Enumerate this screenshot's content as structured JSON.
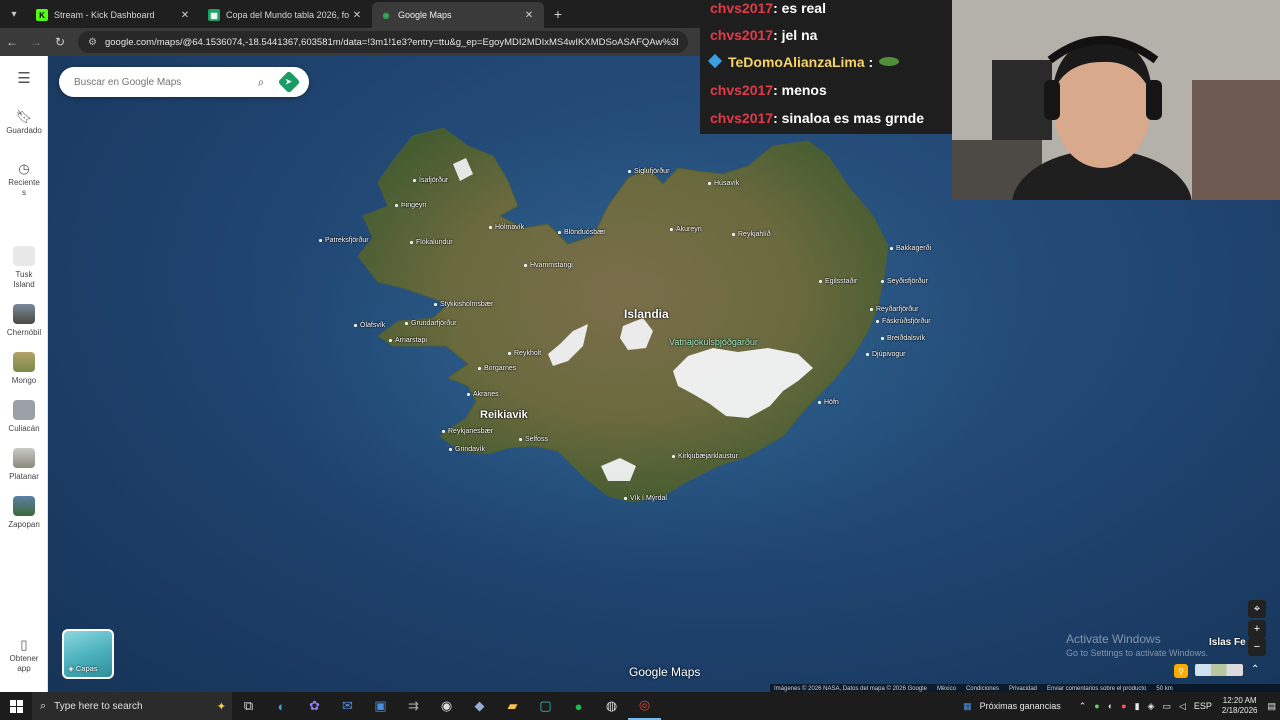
{
  "browser": {
    "tabs": [
      {
        "label": "Stream - Kick Dashboard",
        "favicon": "kick-icon",
        "color": "#53fc18"
      },
      {
        "label": "Copa del Mundo tabla 2026, fo",
        "favicon": "sheets-icon",
        "color": "#1ea362"
      },
      {
        "label": "Google Maps",
        "favicon": "maps-icon",
        "color": "#34a853"
      }
    ],
    "url": "google.com/maps/@64.1536074,-18.5441367,603581m/data=!3m1!1e3?entry=ttu&g_ep=EgoyMDI2MDIxMS4wIKXMDSoASAFQAw%3D%3D"
  },
  "rail": {
    "items": [
      {
        "label": "Guardado",
        "icon": "bookmark-icon"
      },
      {
        "label": "Reciente s",
        "icon": "history-icon"
      },
      {
        "label": "Tusk Island",
        "icon": "place-thumb"
      },
      {
        "label": "Chernóbil",
        "icon": "place-thumb"
      },
      {
        "label": "Mongo",
        "icon": "place-thumb"
      },
      {
        "label": "Culiacán",
        "icon": "place-thumb"
      },
      {
        "label": "Platanar",
        "icon": "place-thumb"
      },
      {
        "label": "Zapopan",
        "icon": "place-thumb"
      },
      {
        "label": "Obtener app",
        "icon": "phone-icon"
      }
    ]
  },
  "search": {
    "placeholder": "Buscar en Google Maps"
  },
  "map": {
    "places": {
      "country": "Islandia",
      "capital": "Reikiavik",
      "glacier": "Vatnajökulsþjóðgarður",
      "isafjordur": "Ísafjörður",
      "thingeyri": "Þingeyri",
      "patreksfjordur": "Patreksfjörður",
      "flokalundur": "Flókalundur",
      "holmavik": "Hólmavík",
      "blonduos": "Blönduósbær",
      "hvammstangi": "Hvammstangi",
      "siglufjordur": "Siglufjörður",
      "husavik": "Húsavík",
      "akureyri": "Akureyri",
      "reykjahlid": "Reykjahlíð",
      "bakkagerdi": "Bakkagerði",
      "egilsstadir": "Egilsstaðir",
      "seydisfjordur": "Seyðisfjörður",
      "reydarfjordur": "Reyðarfjörður",
      "faskrudsfjordur": "Fáskrúðsfjörður",
      "breiddalsvik": "Breiðdalsvík",
      "djupivogur": "Djúpivogur",
      "hofn": "Höfn",
      "stykkisholmur": "Stykkishólmsbær",
      "olafsvik": "Ólafsvík",
      "grundarfjordur": "Grundarfjörður",
      "arnarstapi": "Arnarstapi",
      "reykholt": "Reykholt",
      "borgarnes": "Borgarnes",
      "akranes": "Akranes",
      "reykjanesbaer": "Reykjanesbær",
      "grindavik": "Grindavík",
      "selfoss": "Selfoss",
      "kirkjubaejarklaustur": "Kirkjubæjarklaustur",
      "vik": "Vík í Mýrdal",
      "faroe": "Islas Fe"
    },
    "layers_label": "Capas",
    "logo": "Google Maps",
    "attribution": [
      "Imágenes © 2026 NASA, Datos del mapa © 2026 Google",
      "México",
      "Condiciones",
      "Privacidad",
      "Enviar comentarios sobre el producto",
      "50 km"
    ]
  },
  "watermark": {
    "title": "Activate Windows",
    "subtitle": "Go to Settings to activate Windows."
  },
  "chat": [
    {
      "user": "chvs2017",
      "text": ": es real"
    },
    {
      "user": "chvs2017",
      "text": ": jel na"
    },
    {
      "user": "TeDomoAlianzaLima",
      "text": " :"
    },
    {
      "user": "chvs2017",
      "text": ": menos"
    },
    {
      "user": "chvs2017",
      "text": ": sinaloa es mas grnde"
    }
  ],
  "taskbar": {
    "search_placeholder": "Type here to search",
    "weather": "Próximas ganancias",
    "lang": "ESP",
    "time": "12:20 AM",
    "date": "2/18/2026"
  },
  "colors": {
    "chat_user": "#e33a4a",
    "chat_user_alt": "#f5d36a",
    "land": "#6b6a3f",
    "ice": "#f4f6f8",
    "ocean": "#234a77"
  }
}
